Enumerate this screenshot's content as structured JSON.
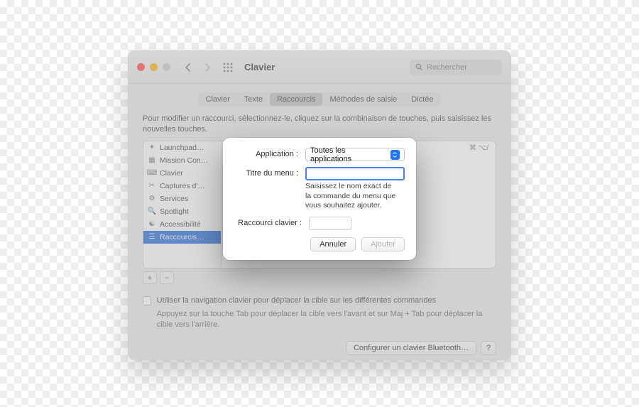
{
  "window": {
    "title": "Clavier",
    "search_placeholder": "Rechercher"
  },
  "tabs": {
    "items": [
      "Clavier",
      "Texte",
      "Raccourcis",
      "Méthodes de saisie",
      "Dictée"
    ],
    "active": "Raccourcis"
  },
  "instruction": "Pour modifier un raccourci, sélectionnez-le, cliquez sur la combinaison de touches, puis saisissez les nouvelles touches.",
  "sidebar": {
    "items": [
      {
        "label": "Launchpad…",
        "icon": "rocket"
      },
      {
        "label": "Mission Con…",
        "icon": "grid"
      },
      {
        "label": "Clavier",
        "icon": "keyboard"
      },
      {
        "label": "Captures d'…",
        "icon": "camera"
      },
      {
        "label": "Services",
        "icon": "gear"
      },
      {
        "label": "Spotlight",
        "icon": "search"
      },
      {
        "label": "Accessibilité",
        "icon": "person"
      },
      {
        "label": "Raccourcis…",
        "icon": "app",
        "selected": true
      }
    ]
  },
  "content": {
    "group_header": "Toutes les applications",
    "shortcut_hint": "⌘ ⌥/"
  },
  "below_panel": {
    "add": "+",
    "remove": "−"
  },
  "checkbox": {
    "label": "Utiliser la navigation clavier pour déplacer la cible sur les différentes commandes",
    "help": "Appuyez sur la touche Tab pour déplacer la cible vers l'avant et sur Maj + Tab pour déplacer la cible vers l'arrière."
  },
  "footer": {
    "configure_bt": "Configurer un clavier Bluetooth…",
    "help": "?"
  },
  "sheet": {
    "application_label": "Application :",
    "application_value": "Toutes les applications",
    "menu_title_label": "Titre du menu :",
    "menu_title_value": "",
    "menu_title_help": "Saisissez le nom exact de la commande du menu que vous souhaitez ajouter.",
    "shortcut_label": "Raccourci clavier :",
    "shortcut_value": "",
    "cancel": "Annuler",
    "add": "Ajouter"
  }
}
